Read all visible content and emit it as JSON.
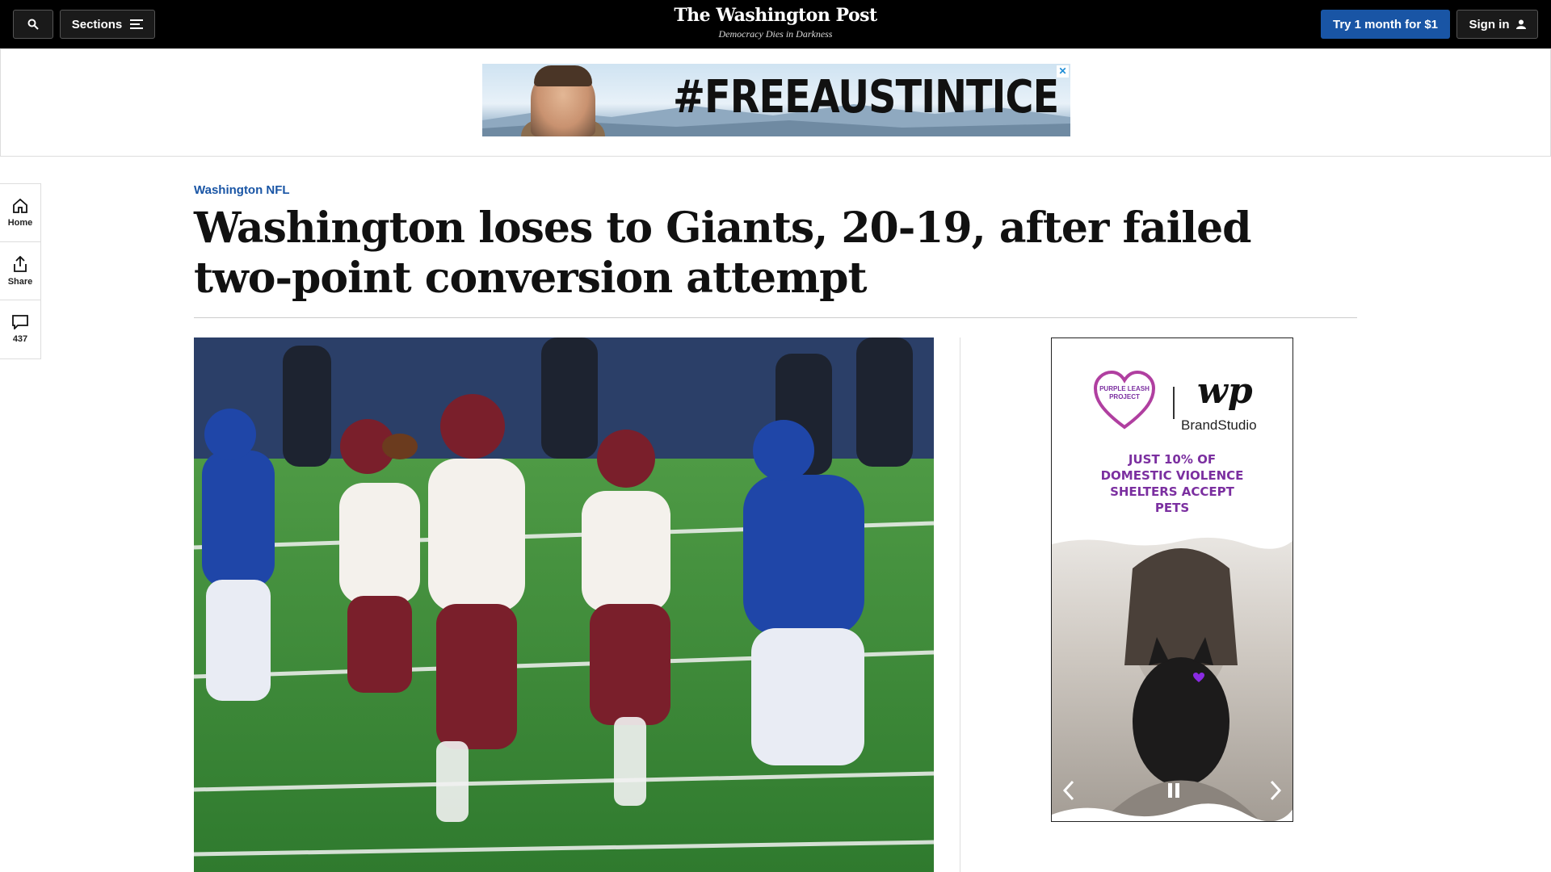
{
  "topbar": {
    "sections_label": "Sections",
    "masthead": "The Washington Post",
    "tagline": "Democracy Dies in Darkness",
    "try_label": "Try 1 month for $1",
    "signin_label": "Sign in"
  },
  "banner_ad": {
    "text": "#FREEAUSTINTICE",
    "close": "✕"
  },
  "rail": {
    "home": "Home",
    "share": "Share",
    "comments": "437"
  },
  "article": {
    "kicker": "Washington NFL",
    "headline": "Washington loses to Giants, 20-19, after failed two-point conversion attempt"
  },
  "side_ad": {
    "logo_text": "wp",
    "brand": "BrandStudio",
    "stat": "JUST 10% OF DOMESTIC VIOLENCE SHELTERS ACCEPT PETS",
    "partner_badge": "PURPLE LEASH PROJECT"
  },
  "colors": {
    "accent_blue": "#1955a5",
    "promo_purple": "#7b2fa0"
  }
}
